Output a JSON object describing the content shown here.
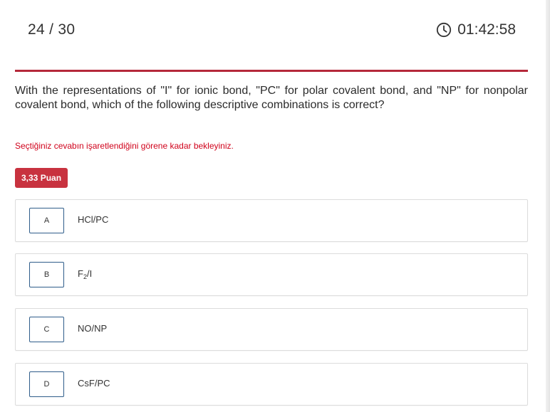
{
  "header": {
    "progress": "24 / 30",
    "timer": "01:42:58",
    "timer_icon": "clock-icon"
  },
  "question": {
    "text": "With the representations of \"I\" for ionic bond, \"PC\" for polar covalent bond, and \"NP\" for nonpolar covalent bond, which of the following descriptive combinations is correct?"
  },
  "warning": "Seçtiğiniz cevabın işaretlendiğini görene kadar bekleyiniz.",
  "points_badge": "3,33 Puan",
  "colors": {
    "accent": "#b5283a",
    "badge": "#c8323f",
    "warning": "#d0021b",
    "letter_border": "#2f5d8a"
  },
  "options": [
    {
      "letter": "A",
      "answer": "HCl/PC"
    },
    {
      "letter": "B",
      "answer_main": "F",
      "answer_sub": "2",
      "answer_rest": "/I"
    },
    {
      "letter": "C",
      "answer": "NO/NP"
    },
    {
      "letter": "D",
      "answer": "CsF/PC"
    }
  ]
}
